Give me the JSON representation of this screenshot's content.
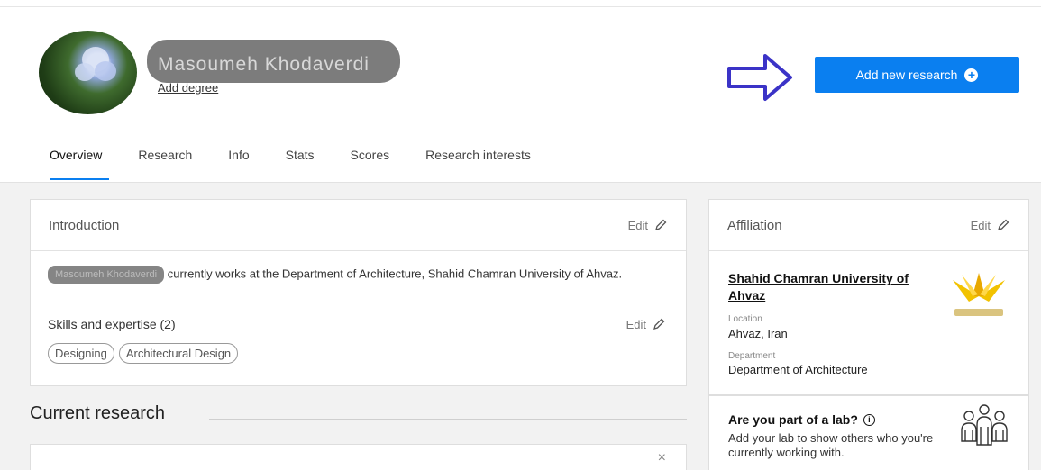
{
  "profile": {
    "name": "Masoumeh Khodaverdi",
    "add_degree": "Add degree",
    "add_research_label": "Add new research"
  },
  "tabs": [
    {
      "label": "Overview",
      "active": true
    },
    {
      "label": "Research"
    },
    {
      "label": "Info"
    },
    {
      "label": "Stats"
    },
    {
      "label": "Scores"
    },
    {
      "label": "Research interests"
    }
  ],
  "introduction": {
    "title": "Introduction",
    "edit": "Edit",
    "name_blur": "Masoumeh Khodaverdi",
    "text": "currently works at the Department of Architecture, Shahid Chamran University of Ahvaz.",
    "skills_title": "Skills and expertise (2)",
    "skills_edit": "Edit",
    "skills": [
      "Designing",
      "Architectural Design"
    ]
  },
  "current_research": {
    "title": "Current research",
    "close": "×"
  },
  "affiliation": {
    "title": "Affiliation",
    "edit": "Edit",
    "university": "Shahid Chamran University of Ahvaz",
    "location_label": "Location",
    "location": "Ahvaz, Iran",
    "department_label": "Department",
    "department": "Department of Architecture"
  },
  "lab": {
    "title": "Are you part of a lab?",
    "text": "Add your lab to show others who you're currently working with."
  },
  "colors": {
    "accent": "#0a7ff0",
    "annotation_arrow": "#3b33c7"
  }
}
